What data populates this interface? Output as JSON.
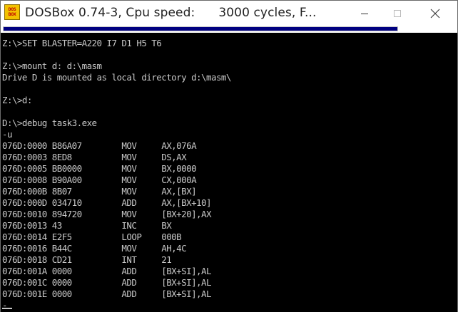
{
  "window": {
    "title": "DOSBox 0.74-3, Cpu speed:      3000 cycles, F...",
    "icon_text_top": "DOS",
    "icon_text_bottom": "BOX",
    "icon": "dosbox-icon",
    "controls": [
      "minimize-icon",
      "maximize-icon",
      "close-icon"
    ]
  },
  "console": {
    "lines": [
      "Z:\\>SET BLASTER=A220 I7 D1 H5 T6",
      "",
      "Z:\\>mount d: d:\\masm",
      "Drive D is mounted as local directory d:\\masm\\",
      "",
      "Z:\\>d:",
      "",
      "D:\\>debug task3.exe",
      "-u",
      "076D:0000 B86A07        MOV     AX,076A",
      "076D:0003 8ED8          MOV     DS,AX",
      "076D:0005 BB0000        MOV     BX,0000",
      "076D:0008 B90A00        MOV     CX,000A",
      "076D:000B 8B07          MOV     AX,[BX]",
      "076D:000D 034710        ADD     AX,[BX+10]",
      "076D:0010 894720        MOV     [BX+20],AX",
      "076D:0013 43            INC     BX",
      "076D:0014 E2F5          LOOP    000B",
      "076D:0016 B44C          MOV     AH,4C",
      "076D:0018 CD21          INT     21",
      "076D:001A 0000          ADD     [BX+SI],AL",
      "076D:001C 0000          ADD     [BX+SI],AL",
      "076D:001E 0000          ADD     [BX+SI],AL",
      "-"
    ]
  },
  "colors": {
    "terminal_bg": "#000000",
    "terminal_fg": "#c8c8c8",
    "menu_bar": "#000080",
    "icon_bg": "#f2c200"
  }
}
